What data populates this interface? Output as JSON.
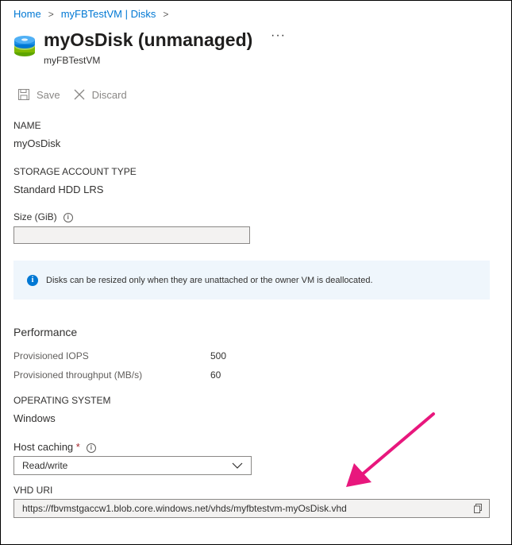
{
  "breadcrumb": {
    "items": [
      {
        "label": "Home"
      },
      {
        "label": "myFBTestVM | Disks"
      }
    ],
    "separator": ">"
  },
  "header": {
    "title": "myOsDisk (unmanaged)",
    "subtitle": "myFBTestVM",
    "more_label": "···",
    "icon": "disk-icon"
  },
  "toolbar": {
    "save_label": "Save",
    "discard_label": "Discard"
  },
  "fields": {
    "name_label": "NAME",
    "name_value": "myOsDisk",
    "storage_type_label": "STORAGE ACCOUNT TYPE",
    "storage_type_value": "Standard HDD LRS",
    "size_label": "Size (GiB)",
    "size_value": ""
  },
  "info_banner": {
    "text": "Disks can be resized only when they are unattached or the owner VM is deallocated."
  },
  "performance": {
    "heading": "Performance",
    "rows": [
      {
        "label": "Provisioned IOPS",
        "value": "500"
      },
      {
        "label": "Provisioned throughput (MB/s)",
        "value": "60"
      }
    ]
  },
  "os": {
    "label": "OPERATING SYSTEM",
    "value": "Windows"
  },
  "host_caching": {
    "label": "Host caching",
    "required_mark": "*",
    "selected": "Read/write"
  },
  "vhd": {
    "label": "VHD URI",
    "value": "https://fbvmstgaccw1.blob.core.windows.net/vhds/myfbtestvm-myOsDisk.vhd"
  },
  "colors": {
    "link": "#0078d4",
    "annotation_arrow": "#e8177d",
    "banner_bg": "#eff6fc"
  }
}
